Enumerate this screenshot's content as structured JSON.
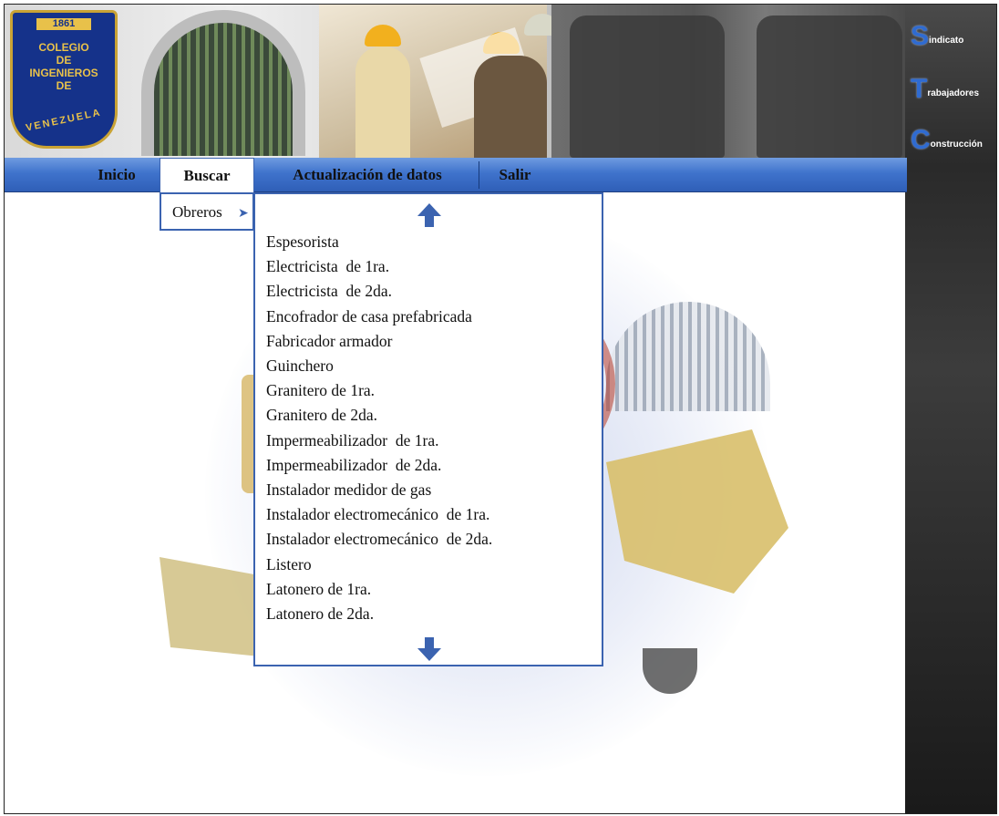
{
  "logo": {
    "year": "1861",
    "lines": [
      "COLEGIO",
      "DE",
      "INGENIEROS",
      "DE"
    ],
    "arc_text": "VENEZUELA"
  },
  "sidebar": {
    "items": [
      {
        "initial": "S",
        "rest": "indicato"
      },
      {
        "initial": "T",
        "rest": "rabajadores"
      },
      {
        "initial": "C",
        "rest": "onstrucción"
      }
    ]
  },
  "nav": {
    "items": [
      {
        "label": "Inicio"
      },
      {
        "label": "Buscar"
      },
      {
        "label": "Actualización de datos"
      },
      {
        "label": "Salir"
      }
    ]
  },
  "submenu": {
    "label": "Obreros"
  },
  "occupations": [
    "Espesorista",
    "Electricista  de 1ra.",
    "Electricista  de 2da.",
    "Encofrador de casa prefabricada",
    "Fabricador armador",
    "Guinchero",
    "Granitero de 1ra.",
    "Granitero de 2da.",
    "Impermeabilizador  de 1ra.",
    "Impermeabilizador  de 2da.",
    "Instalador medidor de gas",
    "Instalador electromecánico  de 1ra.",
    "Instalador electromecánico  de 2da.",
    "Listero",
    "Latonero de 1ra.",
    "Latonero de 2da."
  ],
  "icons": {
    "scroll_up": "arrow-up-icon",
    "scroll_down": "arrow-down-icon",
    "submenu_arrow": "arrow-right-icon"
  },
  "colors": {
    "nav_blue": "#3f73cc",
    "border_blue": "#3b63b0",
    "sidebar_dark": "#2a2a2a",
    "logo_navy": "#15328a",
    "logo_gold": "#e8c14a"
  }
}
